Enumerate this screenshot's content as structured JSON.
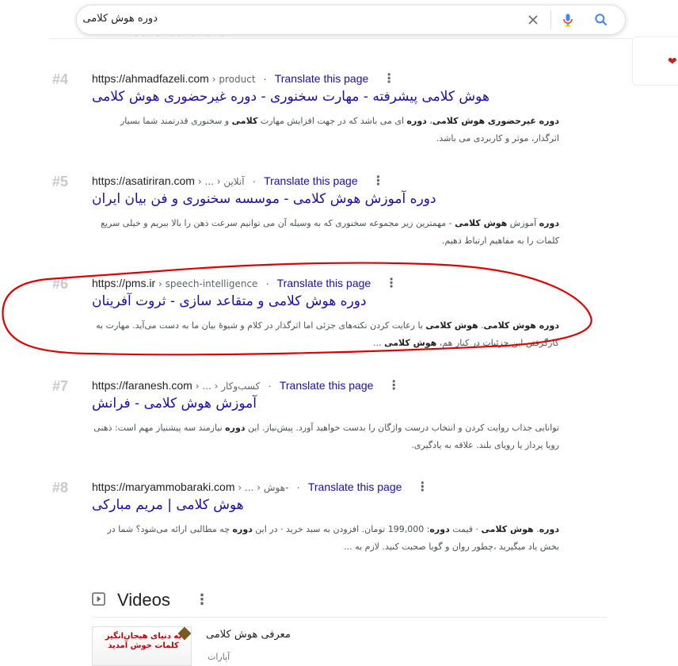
{
  "search": {
    "query": "دوره هوش کلامی"
  },
  "results": [
    {
      "rank": "#4",
      "domain": "https://ahmadfazeli.com",
      "path": "› product",
      "translate": "Translate this page",
      "title": "هوش کلامی پیشرفته - مهارت سخنوری - دوره غیرحضوری هوش کلامی",
      "snippet_a": "دوره غیرحضوری ",
      "snippet_b": "هوش کلامی",
      "snippet_c": "، ",
      "snippet_d": "دوره",
      "snippet_e": " ای می باشد که در جهت افزایش مهارت ",
      "snippet_f": "کلامی",
      "snippet_g": " و سخنوری قدرتمند شما بسیار اثرگذار، موثر و کاربردی می باشد."
    },
    {
      "rank": "#5",
      "domain": "https://asatiriran.com",
      "path": "› ... › آنلاین",
      "translate": "Translate this page",
      "title": "دوره آموزش هوش کلامی - موسسه سخنوری و فن بیان ایران",
      "snippet_a": "دوره",
      "snippet_b": " آموزش ",
      "snippet_c": "هوش کلامی",
      "snippet_d": " - مهمترین زیر مجموعه سخنوری که به وسیله آن می توانیم سرعت ذهن را بالا ببریم و خیلی سریع کلمات را به مفاهیم ارتباط دهیم."
    },
    {
      "rank": "#6",
      "domain": "https://pms.ir",
      "path": "› speech-intelligence",
      "translate": "Translate this page",
      "title": "دوره هوش کلامی و متقاعد سازی - ثروت آفرینان",
      "snippet_a": "دوره هوش کلامی",
      "snippet_b": ". ",
      "snippet_c": "هوش کلامی",
      "snippet_d": " با رعایت کردن نکته‌های جزئی اما اثرگذار در کلام و شیوهٔ بیان ما به دست می‌آید. مهارت به کارگرفتن این جزئیات در کنار هم، ",
      "snippet_e": "هوش کلامی",
      "snippet_f": " ..."
    },
    {
      "rank": "#7",
      "domain": "https://faranesh.com",
      "path": "› ... › کسب‌وکار",
      "translate": "Translate this page",
      "title": "آموزش هوش کلامی - فرانش",
      "snippet_a": "توانایی جذاب روایت کردن و انتخاب درست واژگان را بدست خواهید آورد. پیش‌نیاز. این ",
      "snippet_b": "دوره",
      "snippet_c": " نیازمند سه پیشنیاز مهم است: ذهنی رویا پرداز یا رویای بلند. علاقه به یادگیری."
    },
    {
      "rank": "#8",
      "domain": "https://maryammobaraki.com",
      "path": "› ... › هوش-",
      "translate": "Translate this page",
      "title": "هوش کلامی | مریم مبارکی",
      "snippet_a": "دوره",
      "snippet_b": ". ",
      "snippet_c": "هوش کلامی",
      "snippet_d": " · قیمت ",
      "snippet_e": "دوره",
      "snippet_f": ": 199,000 تومان. افزودن به سبد خرید · در این ",
      "snippet_g": "دوره",
      "snippet_h": " چه مطالبی ارائه می‌شود؟ شما در بخش یاد میگیرید ،چطور روان و گویا صحبت کنید. لازم به ..."
    }
  ],
  "videos": {
    "heading": "Videos",
    "item_title": "معرفی هوش کلامی",
    "item_source": "آپارات",
    "thumb_text": "به دنیای هیجان‌انگیز کلمات خوش آمدید"
  },
  "colors": {
    "link": "#1a0dab",
    "annotation": "#e00000"
  }
}
